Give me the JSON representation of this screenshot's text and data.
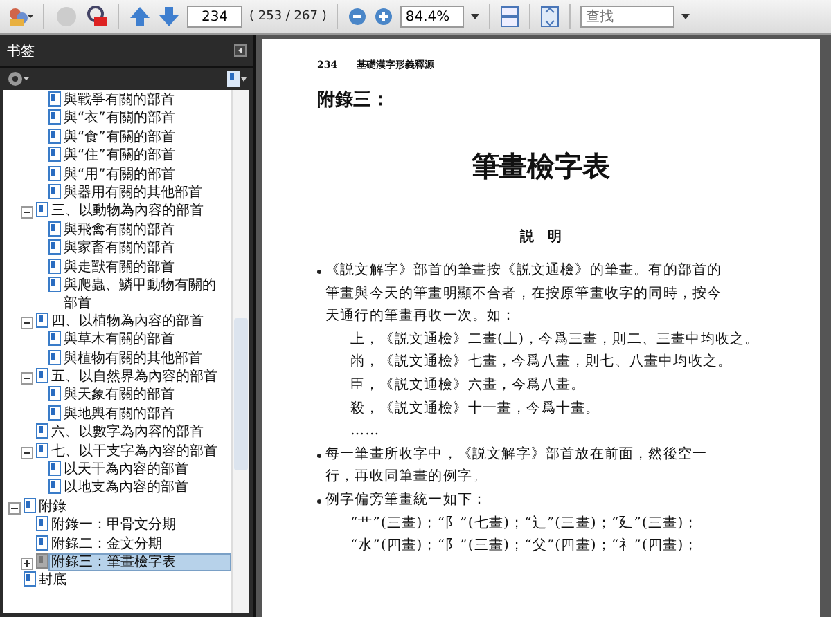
{
  "toolbar": {
    "page_number": "234",
    "page_count": "( 253 / 267 )",
    "zoom": "84.4%",
    "search": {
      "placeholder": "查找"
    }
  },
  "sidebar": {
    "title": "书签",
    "bookmarks_above": [
      {
        "label": "與戰爭有關的部首",
        "selected": false
      },
      {
        "label": "與“衣”有關的部首",
        "selected": false
      },
      {
        "label": "與“食”有關的部首",
        "selected": false
      },
      {
        "label": "與“住”有關的部首",
        "selected": false
      },
      {
        "label": "與“用”有關的部首",
        "selected": false
      },
      {
        "label": "與器用有關的其他部首",
        "selected": false
      }
    ],
    "sections": [
      {
        "label": "三、以動物為內容的部首",
        "selected": false,
        "expanded": true,
        "children": [
          {
            "label": "與飛禽有關的部首",
            "selected": false
          },
          {
            "label": "與家畜有關的部首",
            "selected": false
          },
          {
            "label": "與走獸有關的部首",
            "selected": false
          },
          {
            "label": "與爬蟲、鱗甲動物有關的部首",
            "selected": false
          }
        ]
      },
      {
        "label": "四、以植物為內容的部首",
        "selected": false,
        "expanded": true,
        "children": [
          {
            "label": "與草木有關的部首",
            "selected": false
          },
          {
            "label": "與植物有關的其他部首",
            "selected": false
          }
        ]
      },
      {
        "label": "五、以自然界為內容的部首",
        "selected": false,
        "expanded": true,
        "children": [
          {
            "label": "與天象有關的部首",
            "selected": false
          },
          {
            "label": "與地輿有關的部首",
            "selected": false
          }
        ]
      },
      {
        "label": "六、以數字為內容的部首",
        "selected": false
      },
      {
        "label": "七、以干支字為內容的部首",
        "selected": false,
        "expanded": true,
        "children": [
          {
            "label": "以天干為內容的部首",
            "selected": false
          },
          {
            "label": "以地支為內容的部首",
            "selected": false
          }
        ]
      }
    ],
    "top_level": [
      {
        "label": "附錄",
        "selected": false,
        "expanded": true,
        "children": [
          {
            "label": "附錄一：甲骨文分期",
            "selected": false
          },
          {
            "label": "附錄二：金文分期",
            "selected": false
          },
          {
            "label": "附錄三：筆畫檢字表",
            "selected": true,
            "expanded": false
          }
        ]
      },
      {
        "label": "封底",
        "selected": false
      }
    ]
  },
  "document": {
    "running_head": {
      "page": "234",
      "book_title": "基礎漢字形義釋源"
    },
    "appendix_label": "附錄三：",
    "title": "筆畫檢字表",
    "section_heading": "説　明",
    "blocks": [
      {
        "kind": "bullet",
        "text": "《説文解字》部首的筆畫按《説文通檢》的筆畫。有的部首的筆畫與今天的筆畫明顯不合者，在按原筆畫收字的同時，按今天通行的筆畫再收一次。如："
      },
      {
        "kind": "example",
        "text": "上，《説文通檢》二畫(丄)，今爲三畫，則二、三畫中均收之。"
      },
      {
        "kind": "example",
        "text": "㡀，《説文通檢》七畫，今爲八畫，則七、八畫中均收之。"
      },
      {
        "kind": "example",
        "text": "臣，《説文通檢》六畫，今爲八畫。"
      },
      {
        "kind": "example",
        "text": "殺，《説文通檢》十一畫，今爲十畫。"
      },
      {
        "kind": "example",
        "text": "……"
      },
      {
        "kind": "bullet",
        "text": "每一筆畫所收字中，《説文解字》部首放在前面，然後空一行，再收同筆畫的例字。"
      },
      {
        "kind": "bullet",
        "text": "例字偏旁筆畫統一如下："
      },
      {
        "kind": "example",
        "text": "“艹”(三畫)；“阝”(七畫)；“辶”(三畫)；“廴”(三畫)；"
      },
      {
        "kind": "example",
        "text": "“水”(四畫)；“阝”(三畫)；“父”(四畫)；“礻”(四畫)；"
      }
    ]
  }
}
